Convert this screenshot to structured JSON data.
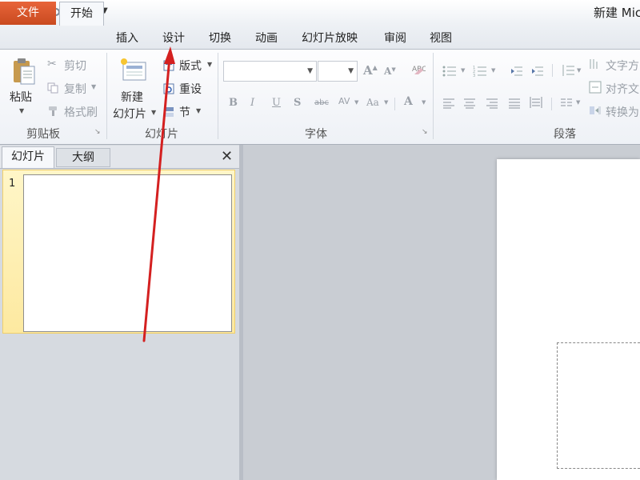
{
  "window": {
    "title": "新建 Mic",
    "app_icon": "P"
  },
  "quick_access": {
    "save_icon": "save-icon",
    "undo_icon": "undo-icon",
    "redo_icon": "redo-icon"
  },
  "tabs": {
    "file": "文件",
    "items": [
      "开始",
      "插入",
      "设计",
      "切换",
      "动画",
      "幻灯片放映",
      "审阅",
      "视图"
    ]
  },
  "ribbon": {
    "clipboard": {
      "paste": "粘贴",
      "cut": "剪切",
      "copy": "复制",
      "format_painter": "格式刷",
      "label": "剪贴板"
    },
    "slides": {
      "new_slide_line1": "新建",
      "new_slide_line2": "幻灯片",
      "layout": "版式",
      "reset": "重设",
      "section": "节",
      "label": "幻灯片"
    },
    "font": {
      "label": "字体",
      "font_name": "",
      "font_size": ""
    },
    "paragraph": {
      "label": "段落",
      "text_direction": "文字方",
      "align_text": "对齐文",
      "convert": "转换为"
    }
  },
  "left_pane": {
    "tab_slides": "幻灯片",
    "tab_outline": "大纲",
    "slide_number": "1"
  },
  "colors": {
    "file_tab": "#d2542a",
    "arrow": "#d42020",
    "selected_thumb": "#fde9a0"
  }
}
